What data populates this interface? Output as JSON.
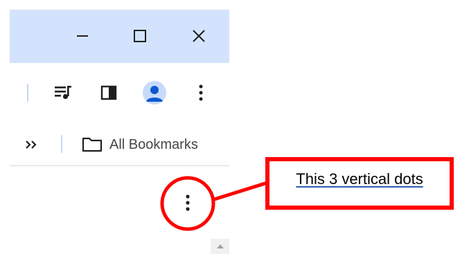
{
  "window_controls": {
    "minimize": "minimize-icon",
    "maximize": "maximize-icon",
    "close": "close-icon"
  },
  "toolbar": {
    "icons": [
      "media-playlist-icon",
      "side-panel-icon",
      "profile-avatar-icon",
      "more-vertical-dots-icon"
    ]
  },
  "bookmarks_bar": {
    "overflow_icon": "double-chevron-right-icon",
    "folder_icon": "folder-icon",
    "folder_label": "All Bookmarks"
  },
  "page": {
    "menu_icon": "more-vertical-dots-icon",
    "scroll_icon": "scroll-up-arrow-icon"
  },
  "annotation": {
    "label": "This 3 vertical dots",
    "color": "#ff0000"
  },
  "colors": {
    "titlebar": "#d3e3fd",
    "avatar_bg": "#c8dafc",
    "avatar_fg": "#0b57d0",
    "icon": "#1f1f1f"
  }
}
